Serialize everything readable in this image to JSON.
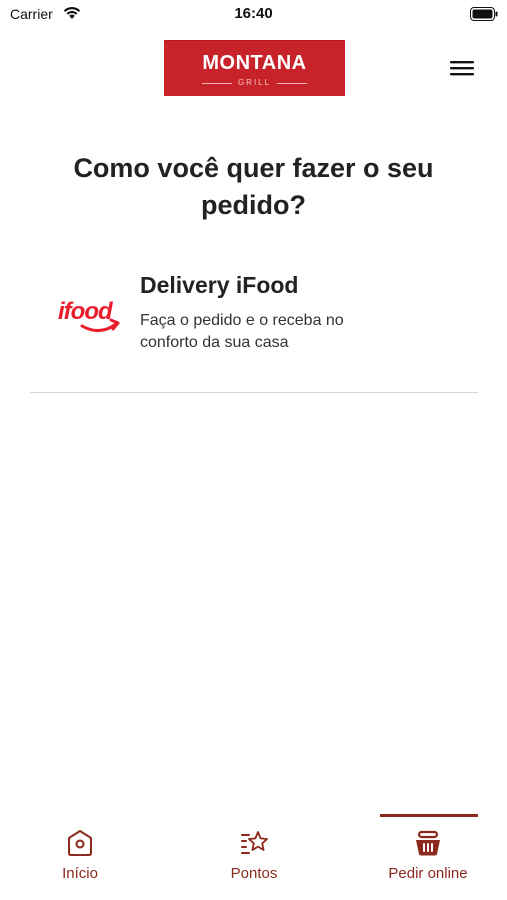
{
  "status_bar": {
    "carrier": "Carrier",
    "time": "16:40"
  },
  "header": {
    "logo_title": "MONTANA",
    "logo_subtitle": "GRILL",
    "menu_icon": "hamburger-menu-icon"
  },
  "main": {
    "title": "Como você quer fazer o seu pedido?",
    "options": [
      {
        "logo_text": "ifood",
        "title": "Delivery iFood",
        "description": "Faça o pedido e o receba no conforto da sua casa"
      }
    ]
  },
  "tab_bar": {
    "active": 2,
    "items": [
      {
        "label": "Início",
        "icon": "home-icon"
      },
      {
        "label": "Pontos",
        "icon": "points-star-icon"
      },
      {
        "label": "Pedir online",
        "icon": "basket-icon"
      }
    ]
  },
  "colors": {
    "brand_red": "#c8232a",
    "tab_accent": "#8b2a1c",
    "ifood_red": "#ea1d2c"
  }
}
